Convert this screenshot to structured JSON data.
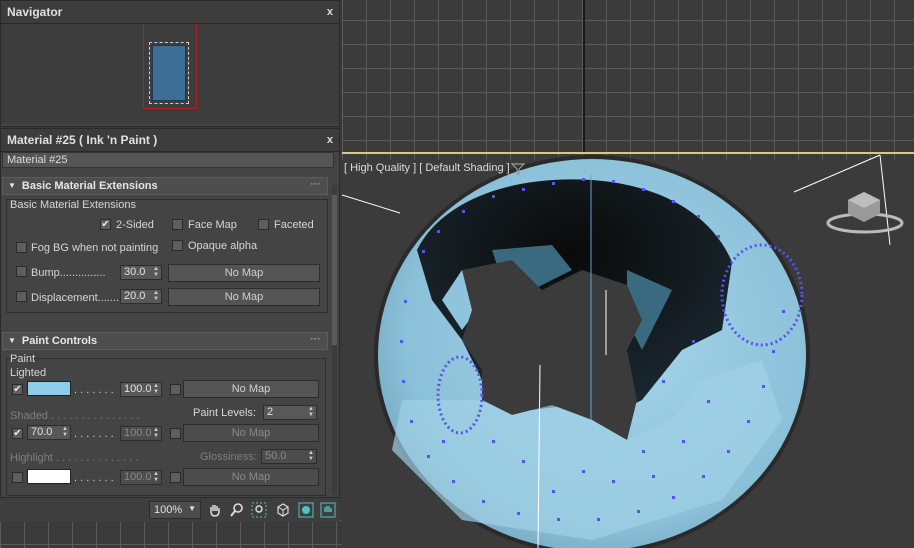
{
  "navigator": {
    "title": "Navigator",
    "close": "x"
  },
  "material_panel": {
    "title": "Material #25  ( Ink 'n Paint )",
    "close": "x",
    "name_value": "Material #25",
    "basic_ext": {
      "title": "Basic Material Extensions",
      "group_label": "Basic Material Extensions",
      "two_sided": "2-Sided",
      "face_map": "Face Map",
      "faceted": "Faceted",
      "fog_bg": "Fog BG when not painting",
      "opaque_alpha": "Opaque alpha",
      "bump_label": "Bump...............",
      "bump_value": "30.0",
      "bump_map": "No Map",
      "disp_label": "Displacement.......",
      "disp_value": "20.0",
      "disp_map": "No Map"
    },
    "paint": {
      "title": "Paint Controls",
      "group_label": "Paint",
      "lighted": "Lighted",
      "lighted_value": "100.0",
      "lighted_map": "No Map",
      "lighted_color": "#8ecdea",
      "shaded": "Shaded . . . . . . . . . . . . . . .",
      "paint_levels_label": "Paint Levels:",
      "paint_levels_value": "2",
      "shaded_pct": "70.0",
      "shaded_value": "100.0",
      "shaded_map": "No Map",
      "highlight": "Highlight . . . . . . . . . . . . . .",
      "glossiness_label": "Glossiness:",
      "glossiness_value": "50.0",
      "highlight_value": "100.0",
      "highlight_map": "No Map",
      "highlight_color": "#ffffff",
      "dots": ". . . . . . ."
    },
    "zoom": "100%"
  },
  "viewport": {
    "label_parts": [
      "[ High Quality ]",
      "[ Default Shading ]"
    ],
    "object_color": "#8ec5dd",
    "vertex_color": "#5555ee"
  },
  "icons": [
    "pan-hand-icon",
    "zoom-magnifier-icon",
    "zoom-region-icon",
    "view-cube-icon",
    "material-icon",
    "hand-tool-icon",
    "viewcube-gizmo-icon",
    "filter-icon"
  ]
}
